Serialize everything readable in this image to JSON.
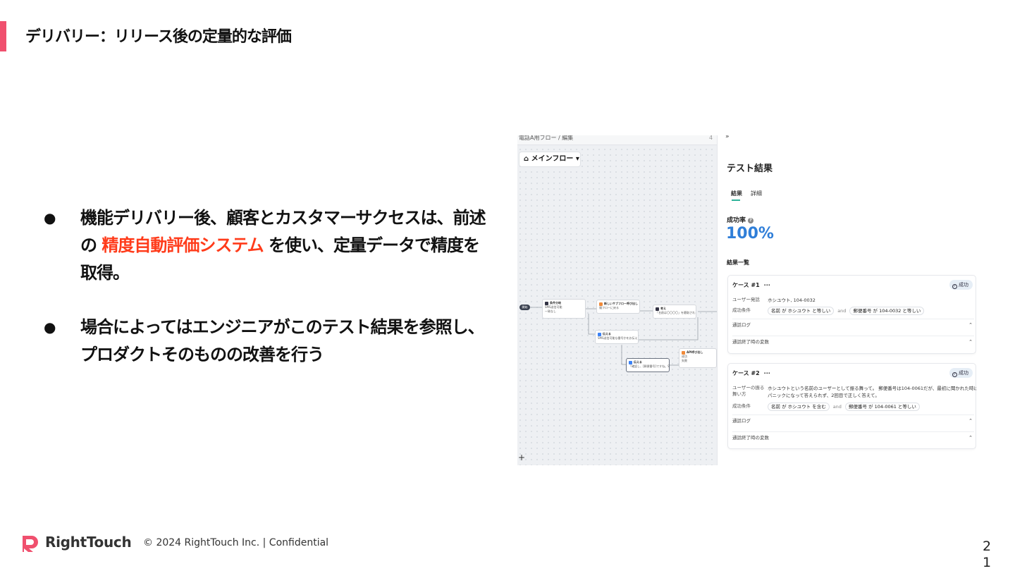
{
  "slide": {
    "title": "デリバリー：リリース後の定量的な評価",
    "accent_color": "#f0506e",
    "bullets": [
      {
        "before": "機能デリバリー後、顧客とカスタマーサクセスは、前述の",
        "highlight": "精度自動評価システム",
        "after": "を使い、定量データで精度を取得。"
      },
      {
        "text": "場合によってはエンジニアがこのテスト結果を参照し、プロダクトそのものの改善を行う"
      }
    ],
    "highlight_color": "#ff3b1a",
    "bullet_glyph": "●"
  },
  "screenshot": {
    "breadcrumb": "電話A用フロー / 編集",
    "page_indicator": "4",
    "flow_selector": "メインフロー",
    "collapse_glyph": "»",
    "plus_glyph": "+",
    "start_label": "開始",
    "nodes": [
      {
        "title": "条件分岐",
        "line1": "SMS送信可能",
        "line2": "一致なし"
      },
      {
        "title": "新しいサブフロー呼び出し",
        "line1": "親フローに戻る",
        "line2": ""
      },
      {
        "title": "考え",
        "line1": "「名前は〇〇〇〇」を聴取されるよ…",
        "line2": ""
      },
      {
        "title": "伝える",
        "line1": "SMS送信可能な番号かをお伝えするメッセー…",
        "line2": ""
      },
      {
        "title": "伝える",
        "line1": "「確認し、[郵便番号]ですね。SMS…",
        "line2": ""
      },
      {
        "title": "API呼び出し",
        "line1": "成功",
        "line2": "失敗"
      }
    ],
    "panel": {
      "title": "テスト結果",
      "tabs": [
        "結果",
        "詳細"
      ],
      "rate_label": "成功率",
      "rate_value": "100%",
      "rate_color": "#2f7ed8",
      "list_label": "結果一覧",
      "cases": [
        {
          "title": "ケース #1",
          "dots": "···",
          "status": "成功",
          "row1_key": "ユーザー発話",
          "row1_value": "ホシユウト, 104-0032",
          "cond_key": "成功条件",
          "cond_a": "名前 が ホシユウト と等しい",
          "and": "and",
          "cond_b": "郵便番号 が 104-0032 と等しい",
          "acc1": "通話ログ",
          "acc2": "通話終了時の変数"
        },
        {
          "title": "ケース #2",
          "dots": "···",
          "status": "成功",
          "row1_key": "ユーザーの振る舞い方",
          "row1_value_1": "ホシユウトという名前のユーザーとして振る舞って。 郵便番号は104-0061だが、最初に聞かれた時は",
          "row1_value_2": "パニックになって答えられず、2回目で正しく答えて。",
          "cond_key": "成功条件",
          "cond_a": "名前 が ホシユウト を含む",
          "and": "and",
          "cond_b": "郵便番号 が 104-0061 と等しい",
          "acc1": "通話ログ",
          "acc2": "通話終了時の変数"
        }
      ]
    }
  },
  "footer": {
    "brand": "RightTouch",
    "brand_color": "#f0506e",
    "copyright": "© 2024 RightTouch Inc.  |  Confidential",
    "page_number": "21"
  }
}
